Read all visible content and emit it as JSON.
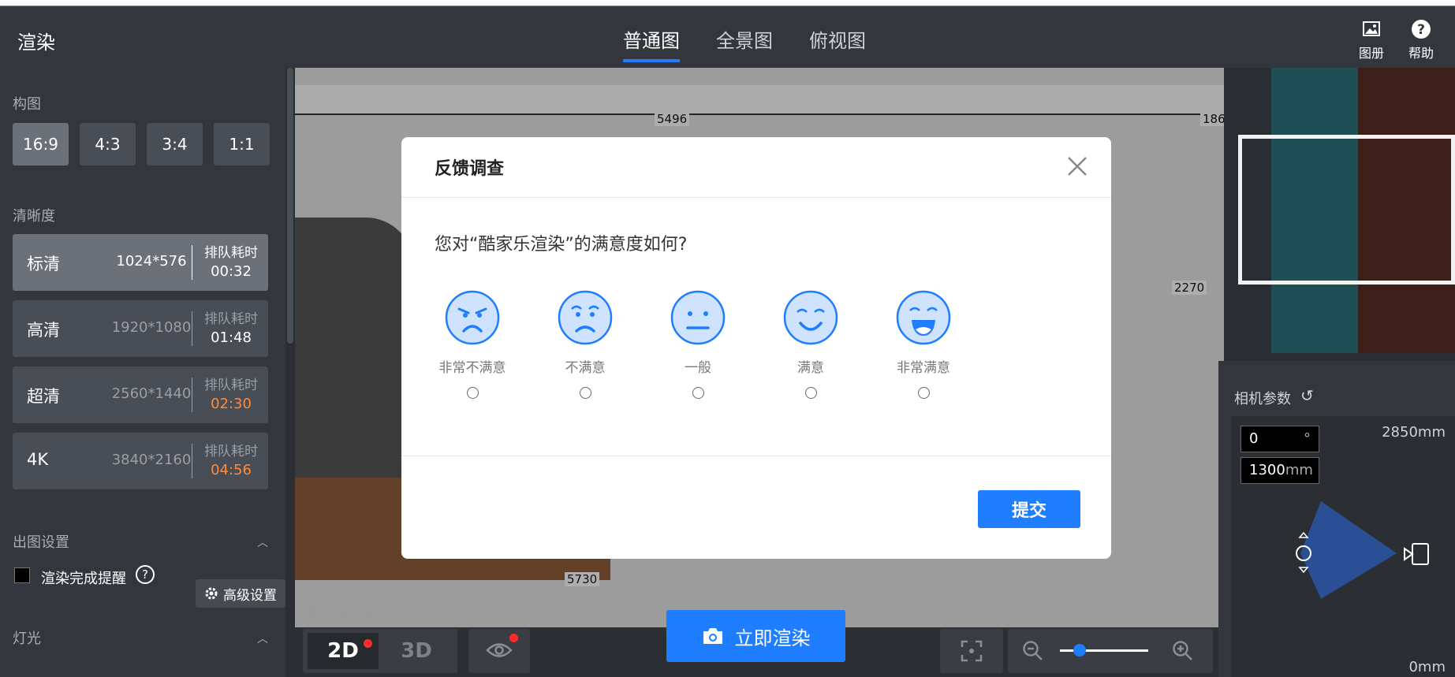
{
  "app": {
    "title": "渲染"
  },
  "tabs": [
    {
      "label": "普通图",
      "active": true
    },
    {
      "label": "全景图",
      "active": false
    },
    {
      "label": "俯视图",
      "active": false
    }
  ],
  "header_buttons": {
    "album": {
      "label": "图册",
      "icon": "image-icon"
    },
    "help": {
      "label": "帮助",
      "icon": "help-icon"
    }
  },
  "left_panel": {
    "composition_label": "构图",
    "ratios": [
      "16:9",
      "4:3",
      "3:4",
      "1:1"
    ],
    "ratio_selected": "16:9",
    "clarity_label": "清晰度",
    "resolutions": [
      {
        "name": "标清",
        "size": "1024*576",
        "queue_label": "排队耗时",
        "time": "00:32",
        "time_color": "#ffffff",
        "active": true
      },
      {
        "name": "高清",
        "size": "1920*1080",
        "queue_label": "排队耗时",
        "time": "01:48",
        "time_color": "#ffffff",
        "active": false
      },
      {
        "name": "超清",
        "size": "2560*1440",
        "queue_label": "排队耗时",
        "time": "02:30",
        "time_color": "#ff8a3d",
        "active": false
      },
      {
        "name": "4K",
        "size": "3840*2160",
        "queue_label": "排队耗时",
        "time": "04:56",
        "time_color": "#ff8a3d",
        "active": false
      }
    ],
    "output_settings_label": "出图设置",
    "render_reminder_label": "渲染完成提醒",
    "lighting_label": "灯光",
    "advanced_label": "高级设置"
  },
  "canvas": {
    "dims": {
      "top_left": "5496",
      "top_right": "186",
      "right": "2270",
      "bottom": "5730"
    },
    "watermark": "酷家乐技术支持"
  },
  "camera": {
    "title": "相机参数",
    "angle_value": "0",
    "angle_unit": "°",
    "height_value": "1300",
    "height_unit": "mm",
    "max_label": "2850mm",
    "min_label": "0mm"
  },
  "bottom_bar": {
    "view_2d": "2D",
    "view_3d": "3D",
    "render_now": "立即渲染",
    "zoom_level": 0.2
  },
  "modal": {
    "title": "反馈调查",
    "question": "您对“酷家乐渲染”的满意度如何?",
    "options": [
      {
        "label": "非常不满意",
        "icon": "very-dissatisfied-face-icon"
      },
      {
        "label": "不满意",
        "icon": "dissatisfied-face-icon"
      },
      {
        "label": "一般",
        "icon": "neutral-face-icon"
      },
      {
        "label": "满意",
        "icon": "satisfied-face-icon"
      },
      {
        "label": "非常满意",
        "icon": "very-satisfied-face-icon"
      }
    ],
    "submit": "提交"
  },
  "colors": {
    "accent": "#1f7dff",
    "orange_time": "#ff8a3d",
    "panel": "#33363c"
  }
}
